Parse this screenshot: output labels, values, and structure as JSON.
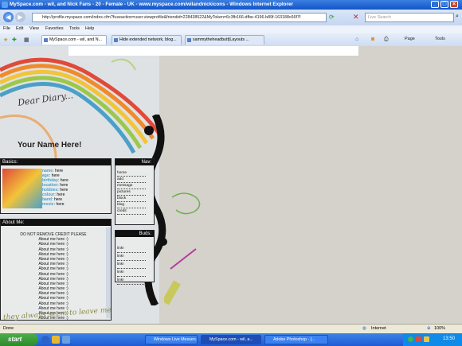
{
  "window": {
    "title": "MySpace.com - wil, and Nick Fans - 20 - Female - UK - www.myspace.com/wilandnickicons - Windows Internet Explorer"
  },
  "address": {
    "url": "http://profile.myspace.com/index.cfm?fuseaction=user.viewprofile&friendid=228438522&MyToken=6c3fb166-dfbe-4196-b89f-163188c66f7f",
    "search_placeholder": "Live Search"
  },
  "menu": [
    "File",
    "Edit",
    "View",
    "Favorites",
    "Tools",
    "Help"
  ],
  "tabs": [
    {
      "label": "MySpace.com - wil, and N...",
      "active": true
    },
    {
      "label": "Hide extended network, blog...",
      "active": false
    },
    {
      "label": "sammytheheadbutt|Layouts ...",
      "active": false
    }
  ],
  "commands": {
    "page": "Page",
    "tools": "Tools"
  },
  "profile": {
    "diary_script": "Dear Diary...",
    "name": "Your Name Here!",
    "basics_header": "Basics:",
    "basics": [
      {
        "key": "name:",
        "val": "here"
      },
      {
        "key": "age:",
        "val": "here"
      },
      {
        "key": "birthday:",
        "val": "here"
      },
      {
        "key": "location:",
        "val": "here"
      },
      {
        "key": "hobbies:",
        "val": "here"
      },
      {
        "key": "colour:",
        "val": "here"
      },
      {
        "key": "band:",
        "val": "here"
      },
      {
        "key": "movie:",
        "val": "here"
      }
    ],
    "about_header": "About Me:",
    "credit_note": "DO NOT REMOVE CREDIT PLEASE",
    "about_lines": [
      "About me here :)",
      "About me here :)",
      "About me here :)",
      "About me here :)",
      "About me here :)",
      "About me here :)",
      "About me here :)",
      "About me here :)",
      "About me here :)",
      "About me here :)",
      "About me here :)",
      "About me here :)",
      "About me here :)",
      "About me here :)",
      "About me here :)",
      "About me here :)",
      "About me here :)"
    ],
    "bottom_script": "they always seem to leave me",
    "nav_header": "Nav:",
    "nav_links": [
      "home",
      "add",
      "message",
      "pictures",
      "block",
      "blog",
      "credit"
    ],
    "buds_header": "Buds:",
    "bud_links": [
      "link!",
      "link!",
      "link!",
      "link!",
      "link!"
    ]
  },
  "status": {
    "left": "Done",
    "zone": "Internet",
    "zoom": "100%"
  },
  "taskbar": {
    "start": "start",
    "tasks": [
      {
        "label": "Windows Live Messen...",
        "active": false
      },
      {
        "label": "MySpace.com - wil, a...",
        "active": true
      },
      {
        "label": "Adobe Photoshop - [...",
        "active": false
      }
    ],
    "clock": "13:50"
  },
  "colors": {
    "accent_blue": "#4aa0c8",
    "rainbow": [
      "#e04a3a",
      "#f08a2a",
      "#f2c43a",
      "#9cc84a",
      "#4aa0c8"
    ]
  }
}
